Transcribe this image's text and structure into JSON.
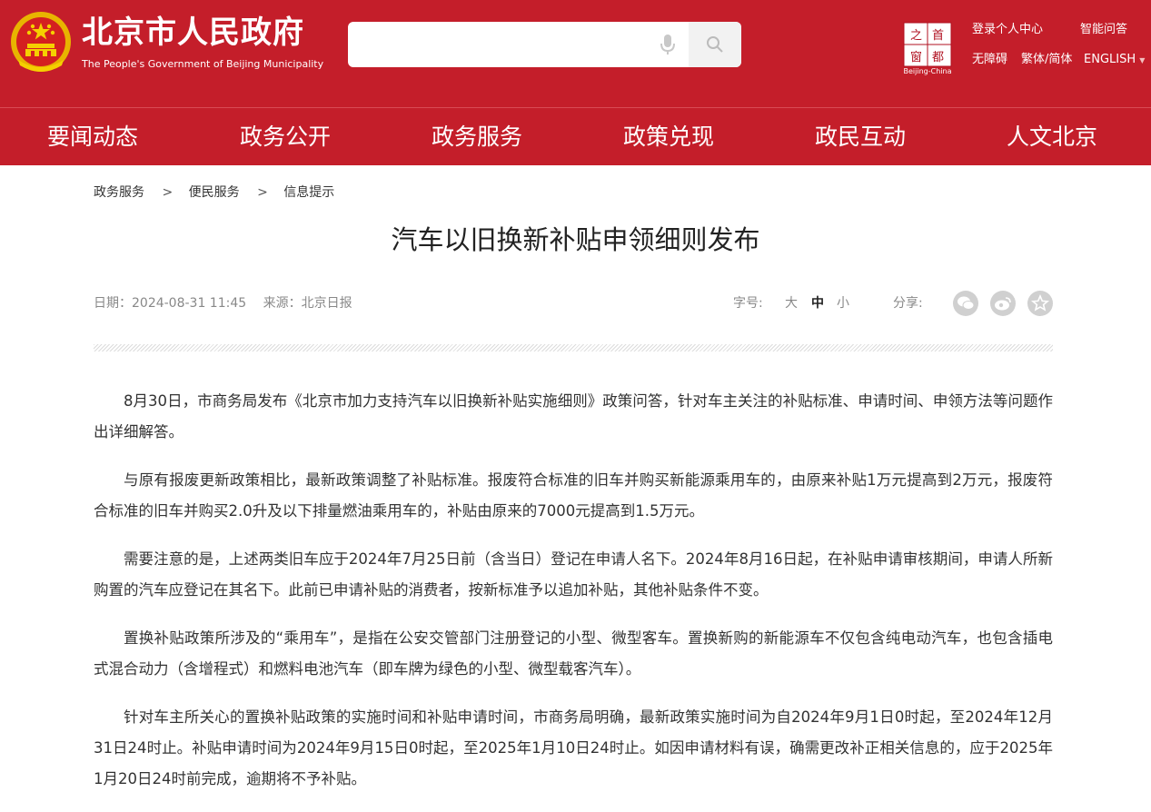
{
  "header": {
    "site_title": "北京市人民政府",
    "site_subtitle": "The People's Government of Beijing Municipality",
    "search_placeholder": "",
    "capital_logo_text": "Beijing-China",
    "links": {
      "login": "登录个人中心",
      "qa": "智能问答",
      "accessibility": "无障碍",
      "traditional_simplified": "繁体/简体",
      "english": "ENGLISH"
    }
  },
  "nav": [
    "要闻动态",
    "政务公开",
    "政务服务",
    "政策兑现",
    "政民互动",
    "人文北京"
  ],
  "breadcrumb": {
    "items": [
      "政务服务",
      "便民服务",
      "信息提示"
    ],
    "separator": ">"
  },
  "article": {
    "title": "汽车以旧换新补贴申领细则发布",
    "date": "日期：2024-08-31 11:45",
    "source": "来源：北京日报",
    "font_size_label": "字号:",
    "font_sizes": [
      "大",
      "中",
      "小"
    ],
    "share_label": "分享:",
    "share_icons": [
      "wechat-icon",
      "weibo-icon",
      "favorite-icon"
    ],
    "paragraphs": [
      "8月30日，市商务局发布《北京市加力支持汽车以旧换新补贴实施细则》政策问答，针对车主关注的补贴标准、申请时间、申领方法等问题作出详细解答。",
      "与原有报废更新政策相比，最新政策调整了补贴标准。报废符合标准的旧车并购买新能源乘用车的，由原来补贴1万元提高到2万元，报废符合标准的旧车并购买2.0升及以下排量燃油乘用车的，补贴由原来的7000元提高到1.5万元。",
      "需要注意的是，上述两类旧车应于2024年7月25日前（含当日）登记在申请人名下。2024年8月16日起，在补贴申请审核期间，申请人所新购置的汽车应登记在其名下。此前已申请补贴的消费者，按新标准予以追加补贴，其他补贴条件不变。",
      "置换补贴政策所涉及的“乘用车”，是指在公安交管部门注册登记的小型、微型客车。置换新购的新能源车不仅包含纯电动汽车，也包含插电式混合动力（含增程式）和燃料电池汽车（即车牌为绿色的小型、微型载客汽车）。",
      "针对车主所关心的置换补贴政策的实施时间和补贴申请时间，市商务局明确，最新政策实施时间为自2024年9月1日0时起，至2024年12月31日24时止。补贴申请时间为2024年9月15日0时起，至2025年1月10日24时止。如因申请材料有误，确需更改补正相关信息的，应于2025年1月20日24时前完成，逾期将不予补贴。"
    ]
  },
  "colors": {
    "brand_red": "#c41e2a",
    "gold": "#f5c400"
  }
}
